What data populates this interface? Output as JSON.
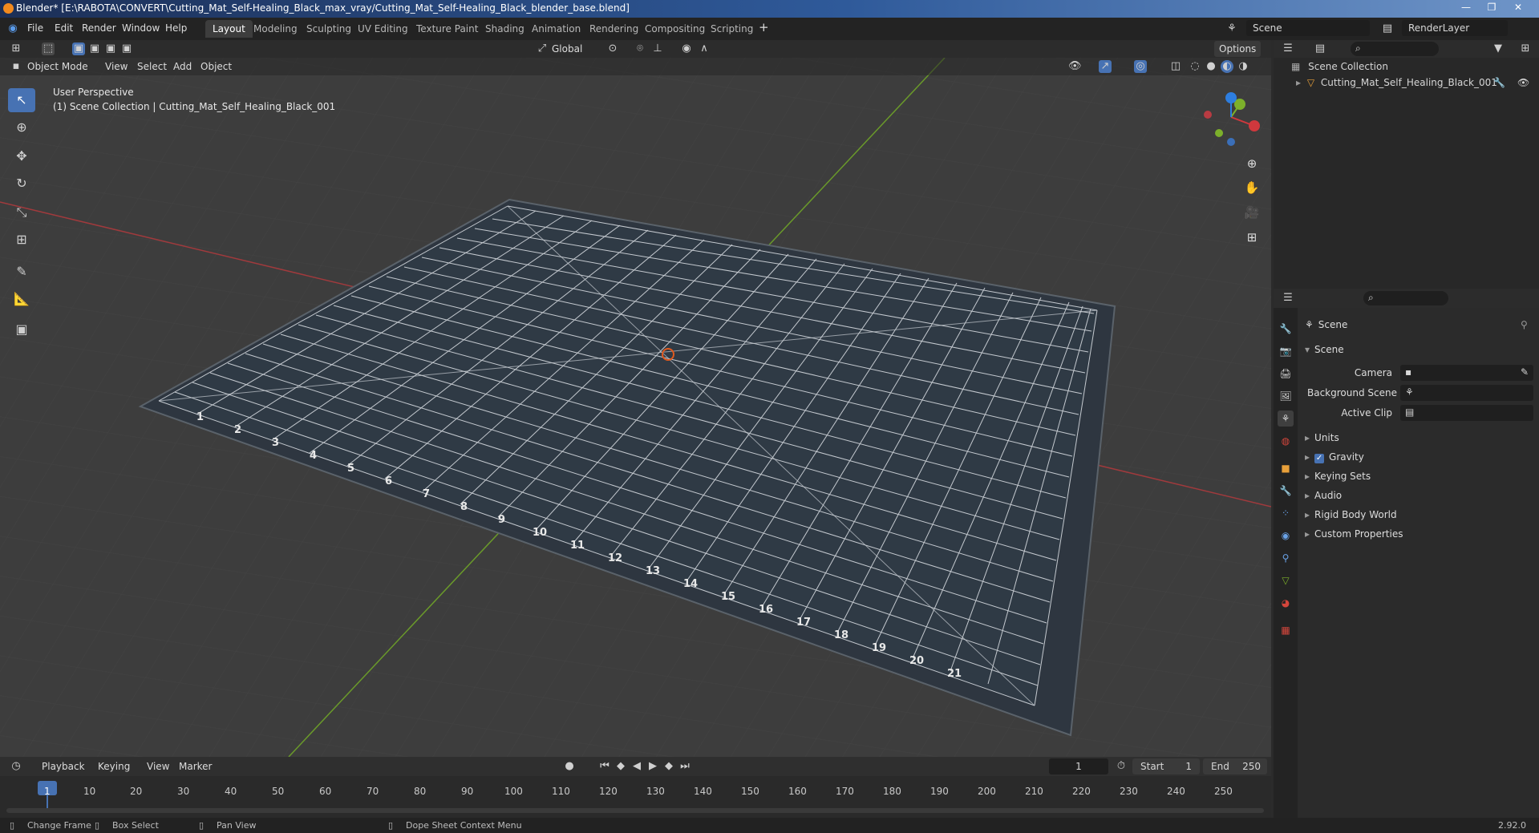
{
  "window": {
    "title": "Blender* [E:\\RABOTA\\CONVERT\\Cutting_Mat_Self-Healing_Black_max_vray/Cutting_Mat_Self-Healing_Black_blender_base.blend]"
  },
  "menu": [
    "File",
    "Edit",
    "Render",
    "Window",
    "Help"
  ],
  "workspaces": [
    "Layout",
    "Modeling",
    "Sculpting",
    "UV Editing",
    "Texture Paint",
    "Shading",
    "Animation",
    "Rendering",
    "Compositing",
    "Scripting"
  ],
  "active_workspace": "Layout",
  "scene_selector": "Scene",
  "render_layer": "RenderLayer",
  "viewport_header": {
    "orientation": "Global",
    "options": "Options"
  },
  "mode_bar": {
    "mode": "Object Mode",
    "view": "View",
    "select": "Select",
    "add": "Add",
    "object": "Object"
  },
  "viewport": {
    "perspective": "User Perspective",
    "collection_info": "(1) Scene Collection | Cutting_Mat_Self_Healing_Black_001"
  },
  "outliner": {
    "root": "Scene Collection",
    "items": [
      "Cutting_Mat_Self_Healing_Black_001"
    ]
  },
  "properties": {
    "context": "Scene",
    "panel": "Scene",
    "fields": {
      "camera": "Camera",
      "background_scene": "Background Scene",
      "active_clip": "Active Clip"
    },
    "sections": [
      "Units",
      "Gravity",
      "Keying Sets",
      "Audio",
      "Rigid Body World",
      "Custom Properties"
    ],
    "gravity_checked": true
  },
  "timeline": {
    "menus": [
      "Playback",
      "Keying",
      "View",
      "Marker"
    ],
    "current_frame": "1",
    "start_label": "Start",
    "start": "1",
    "end_label": "End",
    "end": "250",
    "ticks": [
      "1",
      "10",
      "20",
      "30",
      "40",
      "50",
      "60",
      "70",
      "80",
      "90",
      "100",
      "110",
      "120",
      "130",
      "140",
      "150",
      "160",
      "170",
      "180",
      "190",
      "200",
      "210",
      "220",
      "230",
      "240",
      "250"
    ]
  },
  "status": {
    "change_frame": "Change Frame",
    "box_select": "Box Select",
    "pan_view": "Pan View",
    "context_menu": "Dope Sheet Context Menu",
    "version": "2.92.0"
  },
  "mat_numbers": [
    "1",
    "2",
    "3",
    "4",
    "5",
    "6",
    "7",
    "8",
    "9",
    "10",
    "11",
    "12",
    "13",
    "14",
    "15",
    "16",
    "17",
    "18",
    "19",
    "20",
    "21"
  ],
  "colors": {
    "accent": "#4772b3",
    "x_axis": "#d0383d",
    "y_axis": "#7cb02b",
    "z_axis": "#2d7ee0"
  }
}
